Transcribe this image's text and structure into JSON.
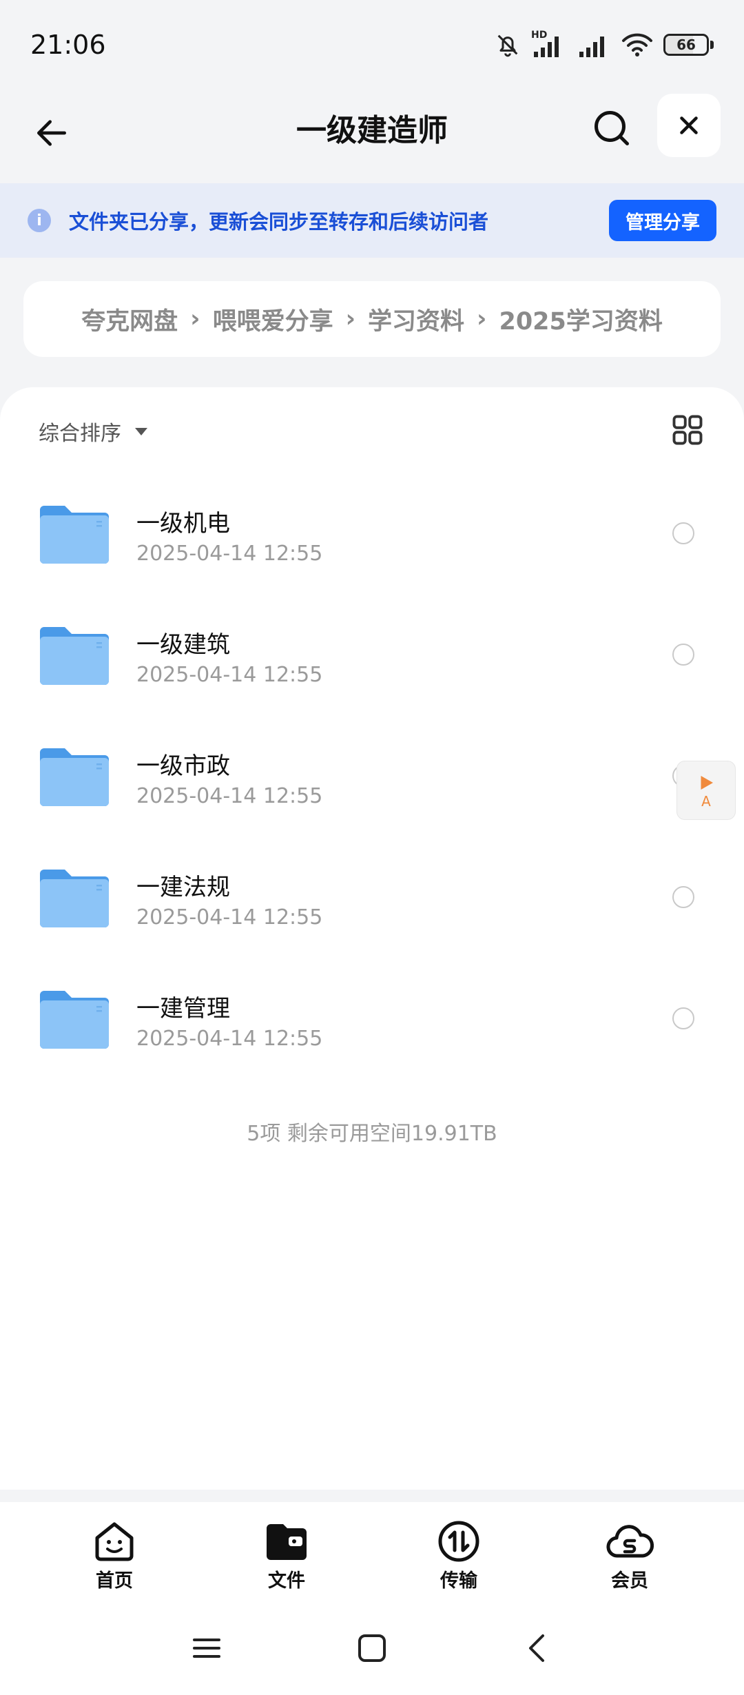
{
  "status_bar": {
    "time": "21:06",
    "hd_label": "HD",
    "battery": "66",
    "battery_level": 0.66,
    "icons": [
      "bell-off-icon",
      "signal-hd-icon",
      "signal-icon",
      "wifi-icon",
      "battery-icon"
    ]
  },
  "header": {
    "title": "一级建造师",
    "back_icon": "arrow-left-icon",
    "search_icon": "search-icon",
    "close_icon": "close-icon"
  },
  "share_banner": {
    "text": "文件夹已分享，更新会同步至转存和后续访问者",
    "button_label": "管理分享",
    "info_glyph": "i"
  },
  "breadcrumb": {
    "items": [
      "夸克网盘",
      "喂喂爱分享",
      "学习资料",
      "2025学习资料"
    ],
    "separator": "›"
  },
  "list": {
    "sort_label": "综合排序",
    "items": [
      {
        "name": "一级机电",
        "date": "2025-04-14 12:55"
      },
      {
        "name": "一级建筑",
        "date": "2025-04-14 12:55"
      },
      {
        "name": "一级市政",
        "date": "2025-04-14 12:55"
      },
      {
        "name": "一建法规",
        "date": "2025-04-14 12:55"
      },
      {
        "name": "一建管理",
        "date": "2025-04-14 12:55"
      }
    ],
    "summary": "5项 剩余可用空间19.91TB"
  },
  "float_widget": {
    "label": "A"
  },
  "bottom_nav": {
    "items": [
      {
        "label": "首页",
        "icon": "home-face-icon"
      },
      {
        "label": "文件",
        "icon": "folder-icon"
      },
      {
        "label": "传输",
        "icon": "transfer-icon"
      },
      {
        "label": "会员",
        "icon": "member-cloud-icon"
      }
    ]
  },
  "colors": {
    "accent": "#1463ff",
    "banner_bg": "#e7ecf8",
    "banner_text": "#1a4fd6",
    "folder": "#5aa8f0"
  }
}
